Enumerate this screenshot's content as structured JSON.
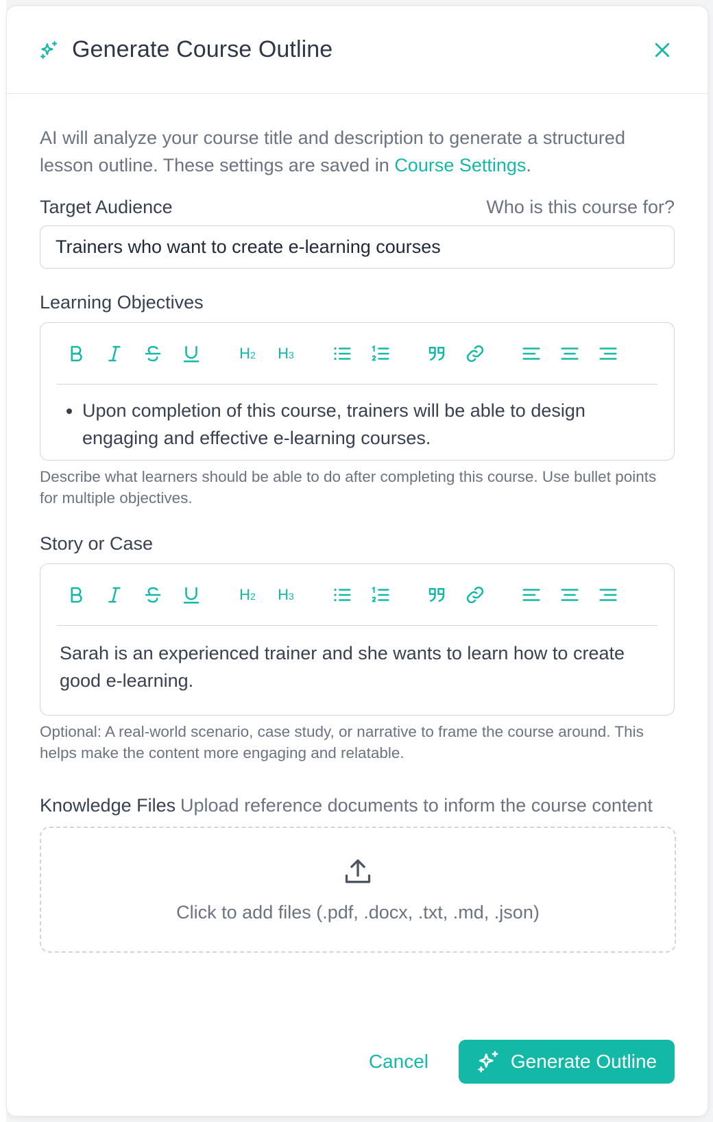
{
  "modal": {
    "title": "Generate Course Outline",
    "intro_text": "AI will analyze your course title and description to generate a structured lesson outline. These settings are saved in ",
    "intro_link": "Course Settings",
    "intro_end": "."
  },
  "target_audience": {
    "label": "Target Audience",
    "hint": "Who is this course for?",
    "value": "Trainers who want to create e-learning courses"
  },
  "learning_objectives": {
    "label": "Learning Objectives",
    "bullets": [
      "Upon completion of this course, trainers will be able to design engaging and effective e-learning courses."
    ],
    "helper": "Describe what learners should be able to do after completing this course. Use bullet points for multiple objectives."
  },
  "story": {
    "label": "Story or Case",
    "content": "Sarah is an experienced trainer and she wants to learn how to create good e-learning.",
    "helper": "Optional: A real-world scenario, case study, or narrative to frame the course around. This helps make the content more engaging and relatable."
  },
  "knowledge_files": {
    "label": "Knowledge Files",
    "description": "Upload reference documents to inform the course content",
    "dropzone_text": "Click to add files (.pdf, .docx, .txt, .md, .json)"
  },
  "toolbar": {
    "h2": "H",
    "h2_sub": "2",
    "h3": "H",
    "h3_sub": "3",
    "icons": [
      "bold-icon",
      "italic-icon",
      "strikethrough-icon",
      "underline-icon",
      "heading2-icon",
      "heading3-icon",
      "bullet-list-icon",
      "ordered-list-icon",
      "quote-icon",
      "link-icon",
      "align-left-icon",
      "align-center-icon",
      "align-right-icon"
    ]
  },
  "footer": {
    "cancel": "Cancel",
    "generate": "Generate Outline"
  },
  "colors": {
    "accent": "#14b8a6",
    "text": "#374151",
    "muted": "#6b7280",
    "border": "#d1d5db"
  }
}
